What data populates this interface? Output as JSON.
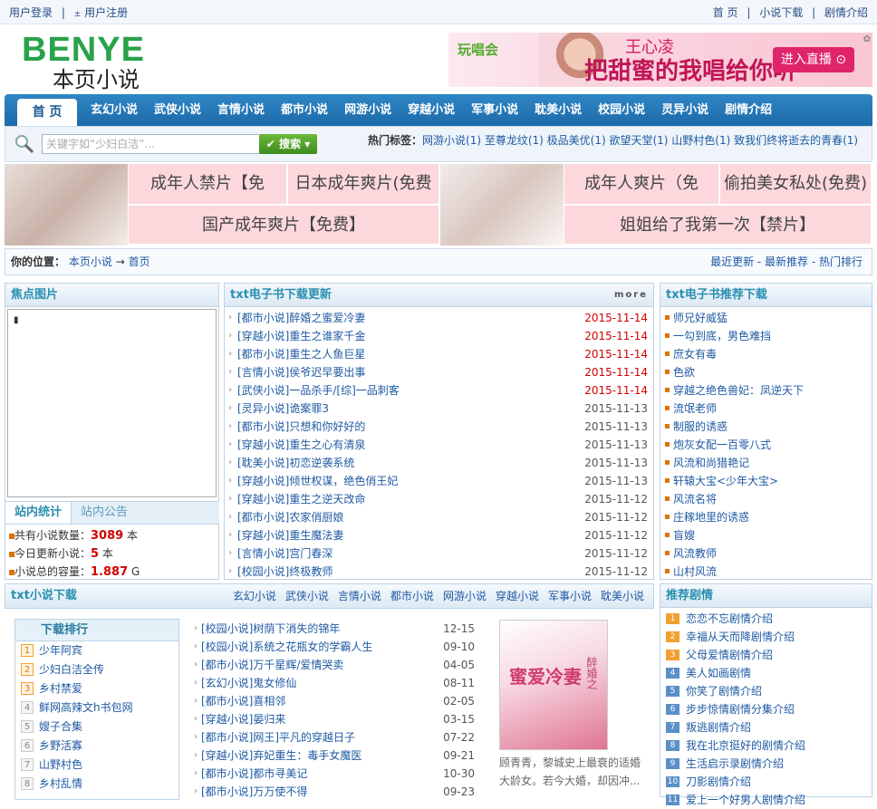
{
  "topbar": {
    "login": "用户登录",
    "register": "用户注册",
    "links": [
      "首 页",
      "小说下载",
      "剧情介绍"
    ]
  },
  "logo": {
    "en": "BENYE",
    "cn": "本页小说"
  },
  "banner": {
    "brand": "玩唱会",
    "name": "王心凌",
    "slogan": "把甜蜜的我唱给你听",
    "button": "进入直播"
  },
  "nav": {
    "home": "首 页",
    "items": [
      "玄幻小说",
      "武侠小说",
      "言情小说",
      "都市小说",
      "网游小说",
      "穿越小说",
      "军事小说",
      "耽美小说",
      "校园小说",
      "灵异小说",
      "剧情介绍"
    ]
  },
  "search": {
    "placeholder": "关键字如“少妇白洁”...",
    "button": "搜索",
    "hot_label": "热门标签：",
    "hot_tags": "网游小说(1)  至尊龙纹(1)  极品美优(1)  欲望天堂(1)  山野村色(1)  致我们终将逝去的青春(1)"
  },
  "ads": {
    "a1": "成年人禁片【免",
    "a2": "日本成年爽片(免费",
    "a3": "国产成年爽片【免费】",
    "a4": "成年人爽片（免",
    "a5": "偷拍美女私处(免费)",
    "a6": "姐姐给了我第一次【禁片】"
  },
  "crumb": {
    "label": "你的位置：",
    "site": "本页小说",
    "arrow": "→",
    "page": "首页",
    "right": "最近更新 - 最新推荐 - 热门排行"
  },
  "focus": {
    "title": "焦点图片"
  },
  "updates": {
    "title": "txt电子书下载更新",
    "more": "more",
    "rows": [
      {
        "t": "[都市小说]醉婚之蜜爱冷妻",
        "d": "2015-11-14",
        "new": true
      },
      {
        "t": "[穿越小说]重生之谁家千金",
        "d": "2015-11-14",
        "new": true
      },
      {
        "t": "[都市小说]重生之人鱼巨星",
        "d": "2015-11-14",
        "new": true
      },
      {
        "t": "[言情小说]侯爷迟早要出事",
        "d": "2015-11-14",
        "new": true
      },
      {
        "t": "[武侠小说]一品杀手/[综]一品刺客",
        "d": "2015-11-14",
        "new": true
      },
      {
        "t": "[灵异小说]诡案罪3",
        "d": "2015-11-13",
        "new": false
      },
      {
        "t": "[都市小说]只想和你好好的",
        "d": "2015-11-13",
        "new": false
      },
      {
        "t": "[穿越小说]重生之心有清泉",
        "d": "2015-11-13",
        "new": false
      },
      {
        "t": "[耽美小说]初恋逆袭系统",
        "d": "2015-11-13",
        "new": false
      },
      {
        "t": "[穿越小说]倾世权谋，绝色俏王妃",
        "d": "2015-11-13",
        "new": false
      },
      {
        "t": "[穿越小说]重生之逆天改命",
        "d": "2015-11-12",
        "new": false
      },
      {
        "t": "[都市小说]农家俏厨娘",
        "d": "2015-11-12",
        "new": false
      },
      {
        "t": "[穿越小说]重生魔法妻",
        "d": "2015-11-12",
        "new": false
      },
      {
        "t": "[言情小说]宫门春深",
        "d": "2015-11-12",
        "new": false
      },
      {
        "t": "[校园小说]终极教师",
        "d": "2015-11-12",
        "new": false
      }
    ]
  },
  "recommend": {
    "title": "txt电子书推荐下载",
    "items": [
      "师兄好威猛",
      "一勾到底，男色难挡",
      "庶女有毒",
      "色欲",
      "穿越之绝色兽妃：凤逆天下",
      "流氓老师",
      "制服的诱惑",
      "炮灰女配一百零八式",
      "风流和尚猎艳记",
      "轩辕大宝<少年大宝>",
      "风流名将",
      "庄稼地里的诱惑",
      "盲嫂",
      "风流教师",
      "山村风流"
    ]
  },
  "stats": {
    "tab1": "站内统计",
    "tab2": "站内公告",
    "r1_label": "共有小说数量：",
    "r1_val": "3089",
    "r1_unit": "本",
    "r2_label": "今日更新小说：",
    "r2_val": "5",
    "r2_unit": "本",
    "r3_label": "小说总的容量：",
    "r3_val": "1.887",
    "r3_unit": "G"
  },
  "downloads": {
    "title": "txt小说下载",
    "cats": [
      "玄幻小说",
      "武侠小说",
      "言情小说",
      "都市小说",
      "网游小说",
      "穿越小说",
      "军事小说",
      "耽美小说"
    ],
    "rank_title": "下载排行",
    "rank": [
      "少年阿宾",
      "少妇白洁全传",
      "乡村禁爱",
      "鲜网高辣文h书包网",
      "嫂子合集",
      "乡野活寡",
      "山野村色",
      "乡村乱情"
    ],
    "list": [
      {
        "t": "[校园小说]树荫下消失的锦年",
        "d": "12-15"
      },
      {
        "t": "[校园小说]系统之花瓶女的学霸人生",
        "d": "09-10"
      },
      {
        "t": "[都市小说]万千星辉/爱情哭卖",
        "d": "04-05"
      },
      {
        "t": "[玄幻小说]鬼女修仙",
        "d": "08-11"
      },
      {
        "t": "[都市小说]喜相邻",
        "d": "02-05"
      },
      {
        "t": "[穿越小说]晏归来",
        "d": "03-15"
      },
      {
        "t": "[都市小说]网王]平凡的穿越日子",
        "d": "07-22"
      },
      {
        "t": "[穿越小说]弃妃重生：毒手女魔医",
        "d": "09-21"
      },
      {
        "t": "[都市小说]都市寻美记",
        "d": "10-30"
      },
      {
        "t": "[都市小说]万万使不得",
        "d": "09-23"
      }
    ],
    "cover_title": "蜜爱冷妻",
    "cover_sub": "醉婚之",
    "cover_desc": "顾青青，黎城史上最衰的适婚大龄女。若今大婚，却因冲..."
  },
  "plots": {
    "title": "推荐剧情",
    "items": [
      "恋恋不忘剧情介绍",
      "幸福从天而降剧情介绍",
      "父母爱情剧情介绍",
      "美人如画剧情",
      "你笑了剧情介绍",
      "步步惊情剧情分集介绍",
      "叛逃剧情介绍",
      "我在北京挺好的剧情介绍",
      "生活启示录剧情介绍",
      "刀影剧情介绍",
      "爱上一个好男人剧情介绍"
    ]
  },
  "colors": {
    "nav": "#1d6aaa",
    "green": "#2aa24a",
    "red": "#d40000",
    "link": "#1f5aa3",
    "pink": "#fcd8dc"
  }
}
